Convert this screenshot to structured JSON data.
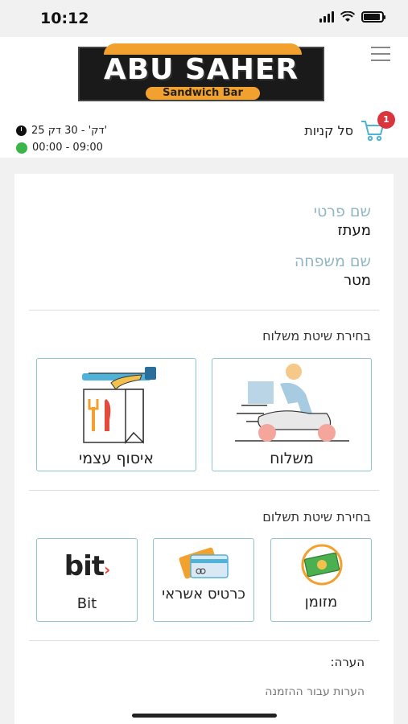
{
  "status_bar": {
    "time": "10:12"
  },
  "header": {
    "logo_title": "ABU SAHER",
    "logo_subtitle": "Sandwich Bar",
    "delivery_time": "25 דק' - 30 דק'",
    "opening_hours": "00:00 - 09:00",
    "cart_label": "סל קניות",
    "cart_count": "1"
  },
  "customer": {
    "first_name_label": "שם פרטי",
    "first_name_value": "מעתז",
    "last_name_label": "שם משפחה",
    "last_name_value": "מטר"
  },
  "shipping": {
    "title": "בחירת שיטת משלוח",
    "options": [
      {
        "label": "משלוח",
        "icon": "delivery-scooter-icon"
      },
      {
        "label": "איסוף עצמי",
        "icon": "takeaway-bag-icon"
      }
    ]
  },
  "payment": {
    "title": "בחירת שיטת תשלום",
    "options": [
      {
        "label": "מזומן",
        "icon": "cash-icon"
      },
      {
        "label": "כרטיס אשראי",
        "icon": "credit-card-icon"
      },
      {
        "label": "Bit",
        "icon": "bit-logo-icon",
        "logo_text": "bit"
      }
    ]
  },
  "note": {
    "label": "הערה:",
    "placeholder": "הערות עבור ההזמנה"
  },
  "colors": {
    "accent_border": "#8fc2d3",
    "label_blue": "#8fb6c4",
    "badge_red": "#d9363e",
    "open_green": "#3bb54a",
    "logo_orange": "#f2a12e"
  }
}
